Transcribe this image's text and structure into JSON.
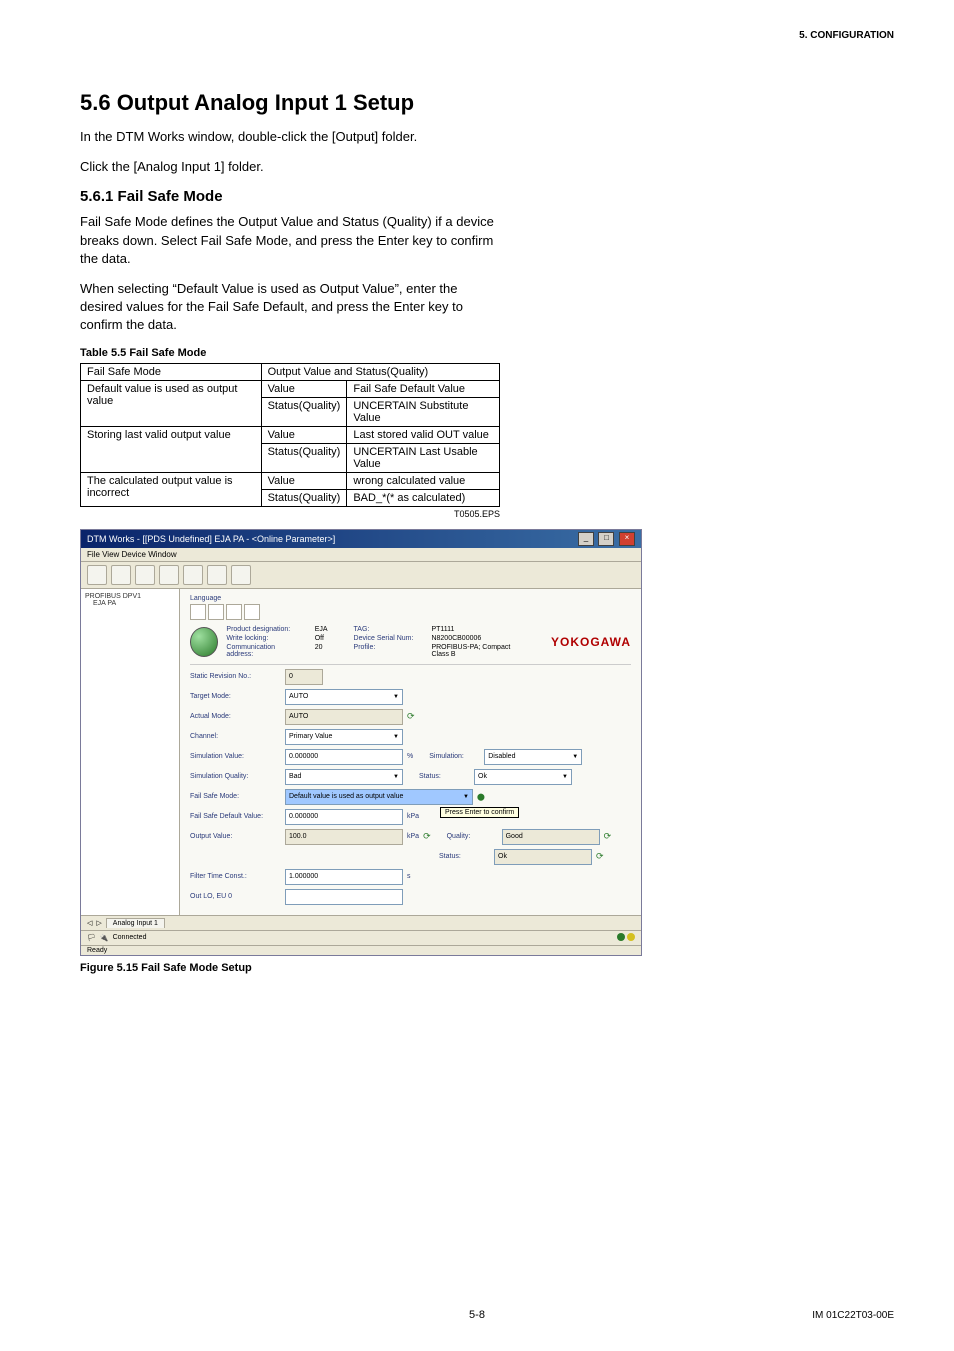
{
  "header": {
    "section": "5.  CONFIGURATION"
  },
  "h1": "5.6 Output Analog Input 1 Setup",
  "p1": "In the DTM Works window, double-click the [Output] folder.",
  "p2": "Click the [Analog Input 1] folder.",
  "h2": "5.6.1 Fail Safe Mode",
  "p3": "Fail Safe Mode defines the Output Value and Status (Quality) if a device breaks down. Select Fail Safe Mode, and press the Enter key to confirm the data.",
  "p4": "When selecting “Default Value is used as Output Value”, enter the desired values for the Fail Safe Default, and press the Enter key to confirm the data.",
  "table_caption": "Table 5.5 Fail Safe Mode",
  "table": {
    "header": [
      "Fail Safe Mode",
      "Output Value and Status(Quality)"
    ],
    "rows": [
      {
        "mode": "Default value is used as output value",
        "items": [
          {
            "k": "Value",
            "v": "Fail Safe Default Value"
          },
          {
            "k": "Status(Quality)",
            "v": "UNCERTAIN Substitute Value"
          }
        ]
      },
      {
        "mode": "Storing last valid output value",
        "items": [
          {
            "k": "Value",
            "v": "Last stored valid OUT value"
          },
          {
            "k": "Status(Quality)",
            "v": "UNCERTAIN Last Usable Value"
          }
        ]
      },
      {
        "mode": "The calculated output value is incorrect",
        "items": [
          {
            "k": "Value",
            "v": "wrong calculated value"
          },
          {
            "k": "Status(Quality)",
            "v": "BAD_*(* as calculated)"
          }
        ]
      }
    ]
  },
  "table_note": "T0505.EPS",
  "dtm": {
    "title": "DTM Works - [[PDS Undefined] EJA PA - <Online Parameter>]",
    "menu": "File  View  Device  Window",
    "tree": {
      "root": "PROFIBUS DPV1",
      "child": "EJA PA"
    },
    "lang_label": "Language",
    "topinfo": {
      "r1k": "Product designation:",
      "r1v": "EJA",
      "r2k": "Write locking:",
      "r2v": "Off",
      "r3k": "Communication address:",
      "r3v": "20",
      "c1k": "TAG:",
      "c1v": "PT1111",
      "c2k": "Device Serial Num:",
      "c2v": "N8200CB00006",
      "c3k": "Profile:",
      "c3v": "PROFIBUS-PA; Compact Class B"
    },
    "brand": "YOKOGAWA",
    "rows": {
      "static_rev": {
        "label": "Static Revision No.:",
        "value": "0"
      },
      "target_mode": {
        "label": "Target Mode:",
        "value": "AUTO"
      },
      "actual_mode": {
        "label": "Actual Mode:",
        "value": "AUTO"
      },
      "channel": {
        "label": "Channel:",
        "value": "Primary Value"
      },
      "sim_value": {
        "label": "Simulation Value:",
        "value": "0.000000",
        "unit": "%"
      },
      "sim_quality": {
        "label": "Simulation Quality:",
        "value": "Bad"
      },
      "sim_enable": {
        "label": "Simulation:",
        "value": "Disabled"
      },
      "sim_status": {
        "label": "Status:",
        "value": "Ok"
      },
      "fail_safe_mode": {
        "label": "Fail Safe Mode:",
        "value": "Default value is used as output value"
      },
      "fail_safe_default": {
        "label": "Fail Safe Default Value:",
        "value": "0.000000",
        "unit": "kPa",
        "hint": "Press Enter to confirm"
      },
      "output_value": {
        "label": "Output Value:",
        "value": "100.0",
        "unit": "kPa"
      },
      "quality": {
        "label": "Quality:",
        "value": "Good"
      },
      "status": {
        "label": "Status:",
        "value": "Ok"
      },
      "filter_time": {
        "label": "Filter Time Const.:",
        "value": "1.000000",
        "unit": "s"
      },
      "out_lo": {
        "label": "Out LO, EU 0"
      }
    },
    "tab": "Analog Input 1",
    "status_bar": {
      "conn": "Connected",
      "ready": "Ready"
    }
  },
  "fig_caption": "Figure 5.15 Fail Safe Mode Setup",
  "footer": {
    "page": "5-8",
    "doc": "IM 01C22T03-00E"
  }
}
